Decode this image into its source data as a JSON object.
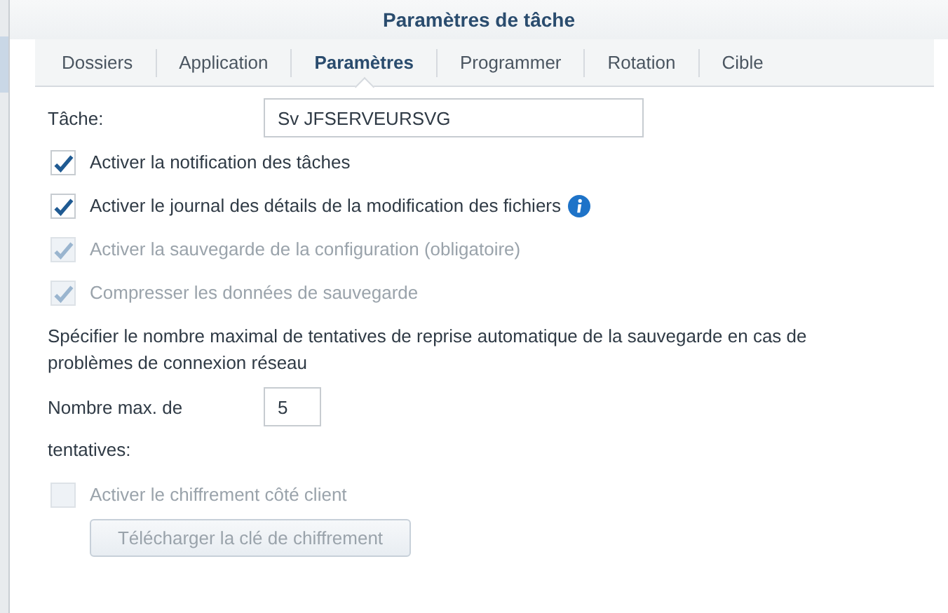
{
  "window": {
    "title": "Paramètres de tâche"
  },
  "tabs": [
    {
      "label": "Dossiers",
      "selected": false
    },
    {
      "label": "Application",
      "selected": false
    },
    {
      "label": "Paramètres",
      "selected": true
    },
    {
      "label": "Programmer",
      "selected": false
    },
    {
      "label": "Rotation",
      "selected": false
    },
    {
      "label": "Cible",
      "selected": false
    }
  ],
  "task_field": {
    "label": "Tâche:",
    "value": "Sv JFSERVEURSVG"
  },
  "options": [
    {
      "label": "Activer la notification des tâches",
      "checked": true,
      "disabled": false,
      "info": false
    },
    {
      "label": "Activer le journal des détails de la modification des fichiers",
      "checked": true,
      "disabled": false,
      "info": true
    },
    {
      "label": "Activer la sauvegarde de la configuration (obligatoire)",
      "checked": true,
      "disabled": true,
      "info": false
    },
    {
      "label": "Compresser les données de sauvegarde",
      "checked": true,
      "disabled": true,
      "info": false
    }
  ],
  "retry_description": "Spécifier le nombre maximal de tentatives de reprise automatique de la sauvegarde en cas de problèmes de connexion réseau",
  "retry_field": {
    "label_lines": [
      "Nombre max. de",
      "tentatives:"
    ],
    "value": "5"
  },
  "encryption": {
    "label": "Activer le chiffrement côté client",
    "checked": false,
    "disabled": true
  },
  "download_button": {
    "label": "Télécharger la clé de chiffrement",
    "disabled": true
  }
}
